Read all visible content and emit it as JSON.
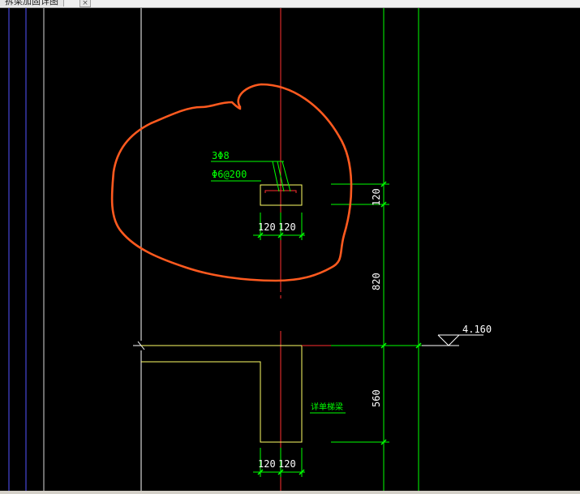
{
  "window": {
    "tab_title": "拆梁加固详图",
    "tab_close_glyph": "×"
  },
  "drawing": {
    "rebar_top_label": "3Φ8",
    "stirrup_label": "Φ6@200",
    "dim_upper_left": "120",
    "dim_upper_right": "120",
    "dim_lower_left": "120",
    "dim_lower_right": "120",
    "dim_vertical_top": "120",
    "dim_vertical_middle": "820",
    "dim_vertical_bottom": "560",
    "elevation_label": "4.160",
    "note_label": "详单梯梁"
  },
  "colors": {
    "background": "#000000",
    "green": "#00ff00",
    "yellow": "#ffff66",
    "red": "#ff3030",
    "orange": "#ff5a1f",
    "white": "#ffffff",
    "blue": "#6666ff"
  }
}
